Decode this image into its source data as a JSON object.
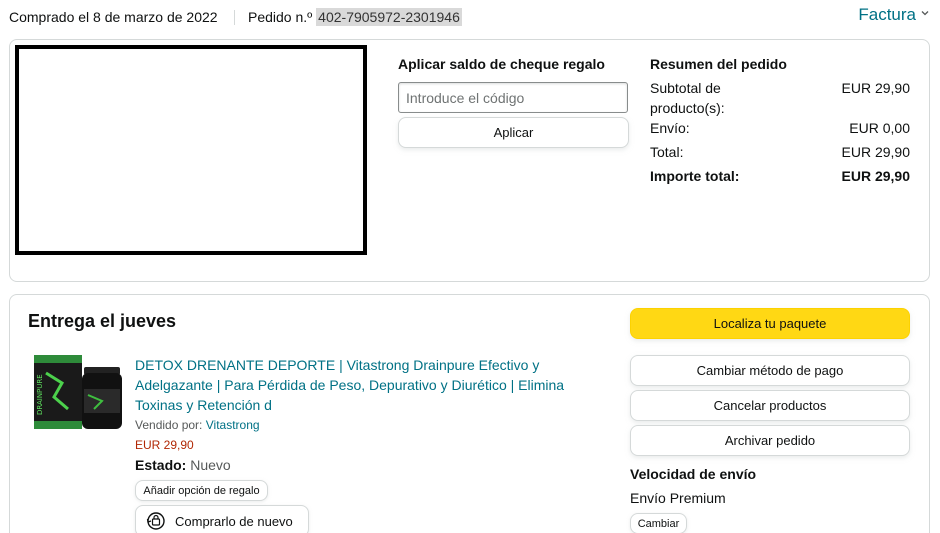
{
  "header": {
    "purchased_text": "Comprado el 8 de marzo de 2022",
    "order_label": "Pedido n.º",
    "order_number": "402-7905972-2301946",
    "invoice_label": "Factura"
  },
  "gift_card": {
    "title": "Aplicar saldo de cheque regalo",
    "placeholder": "Introduce el código",
    "value": "",
    "apply_label": "Aplicar"
  },
  "summary": {
    "title": "Resumen del pedido",
    "rows": [
      {
        "label": "Subtotal de producto(s):",
        "value": "EUR 29,90"
      },
      {
        "label": "Envío:",
        "value": "EUR 0,00"
      },
      {
        "label": "Total:",
        "value": "EUR 29,90"
      },
      {
        "label": "Importe total:",
        "value": "EUR 29,90"
      }
    ]
  },
  "shipment": {
    "delivery_text": "Entrega el jueves",
    "product": {
      "title": "DETOX DRENANTE DEPORTE | Vitastrong Drainpure Efectivo y Adelgazante | Para Pérdida de Peso, Depurativo y Diurético | Elimina Toxinas y Retención d",
      "sold_by_label": "Vendido por:",
      "seller": "Vitastrong",
      "price": "EUR 29,90",
      "state_label": "Estado:",
      "state_value": "Nuevo",
      "gift_option_label": "Añadir opción de regalo",
      "buy_again_label": "Comprarlo de nuevo"
    },
    "actions": {
      "track_label": "Localiza tu paquete",
      "change_payment_label": "Cambiar método de pago",
      "cancel_label": "Cancelar productos",
      "archive_label": "Archivar pedido"
    },
    "shipping_speed": {
      "title": "Velocidad de envío",
      "value": "Envío Premium",
      "change_label": "Cambiar"
    }
  },
  "colors": {
    "link": "#007185",
    "price": "#b12704",
    "primary_button": "#ffd814",
    "border": "#d5d9d9"
  }
}
